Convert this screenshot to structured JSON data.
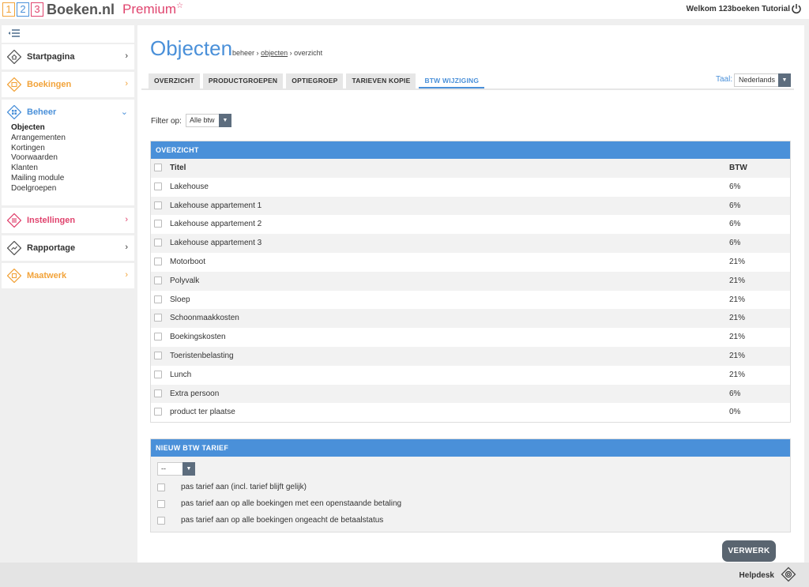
{
  "header": {
    "logo_digits": [
      "1",
      "2",
      "3"
    ],
    "brand": "Boeken.nl",
    "premium": "Premium",
    "premium_star": "☆",
    "welcome": "Welkom 123boeken Tutorial"
  },
  "sidebar": {
    "items": [
      {
        "label": "Startpagina",
        "icon": "home-icon",
        "color": "#333333"
      },
      {
        "label": "Boekingen",
        "icon": "calendar-icon",
        "color": "#f2a33a"
      },
      {
        "label": "Beheer",
        "icon": "settings-icon",
        "color": "#4a90d9",
        "sub": [
          "Objecten",
          "Arrangementen",
          "Kortingen",
          "Voorwaarden",
          "Klanten",
          "Mailing module",
          "Doelgroepen"
        ]
      },
      {
        "label": "Instellingen",
        "icon": "sliders-icon",
        "color": "#e0446e"
      },
      {
        "label": "Rapportage",
        "icon": "chart-icon",
        "color": "#333333"
      },
      {
        "label": "Maatwerk",
        "icon": "puzzle-icon",
        "color": "#f2a33a"
      }
    ]
  },
  "main": {
    "title": "Objecten",
    "breadcrumb": {
      "part1": "beheer",
      "sep": "›",
      "link": "objecten",
      "part3": "overzicht"
    },
    "tabs": [
      "OVERZICHT",
      "PRODUCTGROEPEN",
      "OPTIEGROEP",
      "TARIEVEN KOPIE",
      "BTW WIJZIGING"
    ],
    "active_tab": "BTW WIJZIGING",
    "language": {
      "label": "Taal:",
      "value": "Nederlands"
    },
    "filter": {
      "label": "Filter op:",
      "value": "Alle btw"
    },
    "overview": {
      "title": "OVERZICHT",
      "columns": [
        "Titel",
        "BTW"
      ],
      "rows": [
        {
          "title": "Lakehouse",
          "btw": "6%"
        },
        {
          "title": "Lakehouse appartement 1",
          "btw": "6%"
        },
        {
          "title": "Lakehouse appartement 2",
          "btw": "6%"
        },
        {
          "title": "Lakehouse appartement 3",
          "btw": "6%"
        },
        {
          "title": "Motorboot",
          "btw": "21%"
        },
        {
          "title": "Polyvalk",
          "btw": "21%"
        },
        {
          "title": "Sloep",
          "btw": "21%"
        },
        {
          "title": "Schoonmaakkosten",
          "btw": "21%"
        },
        {
          "title": "Boekingskosten",
          "btw": "21%"
        },
        {
          "title": "Toeristenbelasting",
          "btw": "21%"
        },
        {
          "title": "Lunch",
          "btw": "21%"
        },
        {
          "title": "Extra persoon",
          "btw": "6%"
        },
        {
          "title": "product ter plaatse",
          "btw": "0%"
        }
      ]
    },
    "new_rate": {
      "title": "NIEUW BTW TARIEF",
      "select_value": "--",
      "options": [
        "pas tarief aan (incl. tarief blijft gelijk)",
        "pas tarief aan op alle boekingen met een openstaande betaling",
        "pas tarief aan op alle boekingen ongeacht de betaalstatus"
      ]
    },
    "submit_label": "VERWERK"
  },
  "footer": {
    "helpdesk": "Helpdesk"
  },
  "colors": {
    "accent": "#4a90d9",
    "orange": "#f2a33a",
    "pink": "#e0446e",
    "button": "#5a6570"
  }
}
